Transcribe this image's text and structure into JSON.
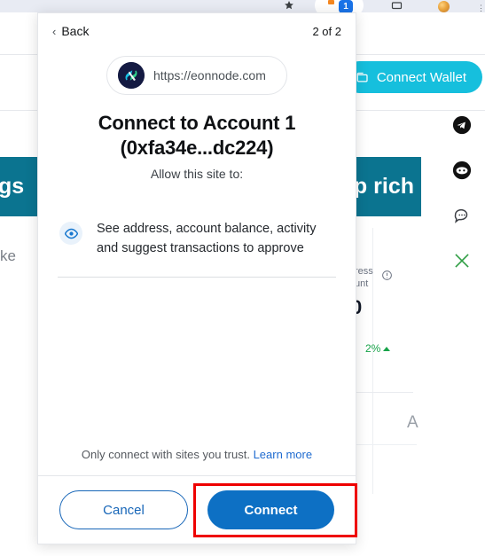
{
  "browser": {
    "icons": [
      {
        "name": "bookmark-star-icon"
      },
      {
        "name": "extensions-icon",
        "badge": "1"
      },
      {
        "name": "wallet-icon"
      },
      {
        "name": "wallet-icon-2"
      },
      {
        "name": "profile-avatar"
      },
      {
        "name": "more-menu-icon",
        "glyph": "⋮"
      }
    ]
  },
  "background_page": {
    "connect_wallet_label": "Connect Wallet",
    "banner_left_text": "gs",
    "banner_right_text": "p rich",
    "fragment_ke": "ke",
    "fragment_address": "ress",
    "fragment_account": "unt",
    "big_number": "0",
    "percent_change": "2%",
    "letter_fragment": "A",
    "social_icons": [
      {
        "name": "telegram-icon"
      },
      {
        "name": "discord-icon"
      },
      {
        "name": "chat-bubble-icon"
      },
      {
        "name": "x-twitter-icon"
      }
    ]
  },
  "modal": {
    "back_label": "Back",
    "page_count": "2 of 2",
    "origin_url": "https://eonnode.com",
    "title": "Connect to Account 1 (0xfa34e...dc224)",
    "subtitle": "Allow this site to:",
    "permissions": [
      {
        "icon": "eye-icon",
        "text": "See address, account balance, activity and suggest transactions to approve"
      }
    ],
    "trust_text": "Only connect with sites you trust.",
    "learn_more_label": "Learn more",
    "cancel_label": "Cancel",
    "connect_label": "Connect"
  },
  "colors": {
    "primary_blue": "#0d70c4",
    "cancel_blue": "#1766b8",
    "cyan": "#16bfdd",
    "teal": "#0b7490",
    "green": "#17a349",
    "highlight_red": "#ee0000"
  }
}
